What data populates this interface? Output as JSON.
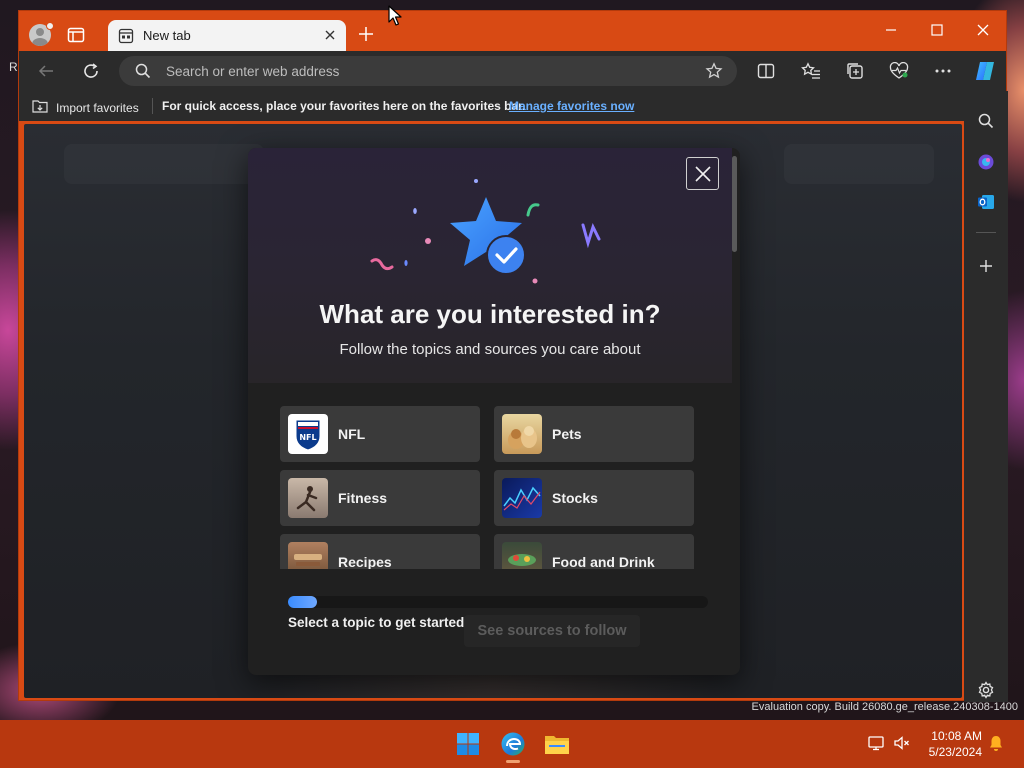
{
  "desktop": {
    "letter": "R",
    "eval_text": "Evaluation copy. Build 26080.ge_release.240308-1400"
  },
  "browser": {
    "tab": {
      "title": "New tab"
    },
    "address_bar": {
      "placeholder": "Search or enter web address",
      "value": ""
    },
    "favorites_bar": {
      "import_label": "Import favorites",
      "message": "For quick access, place your favorites here on the favorites bar.",
      "link": "Manage favorites now"
    }
  },
  "dialog": {
    "title": "What are you interested in?",
    "subtitle": "Follow the topics and sources you care about",
    "topics": [
      {
        "label": "NFL",
        "icon": "nfl-logo"
      },
      {
        "label": "Pets",
        "icon": "pets-photo"
      },
      {
        "label": "Fitness",
        "icon": "fitness-photo"
      },
      {
        "label": "Stocks",
        "icon": "stocks-chart"
      },
      {
        "label": "Recipes",
        "icon": "recipes-photo"
      },
      {
        "label": "Food and Drink",
        "icon": "food-photo"
      }
    ],
    "progress": {
      "fraction": 0.07,
      "text": "Select a topic to get started"
    },
    "next_button": "See sources to follow"
  },
  "taskbar": {
    "time": "10:08 AM",
    "date": "5/23/2024"
  },
  "colors": {
    "window_frame": "#d84a14",
    "toolbar": "#2b2b2b",
    "accent_blue": "#3a8cff",
    "link": "#6ab0ff",
    "taskbar": "#b8380f"
  }
}
